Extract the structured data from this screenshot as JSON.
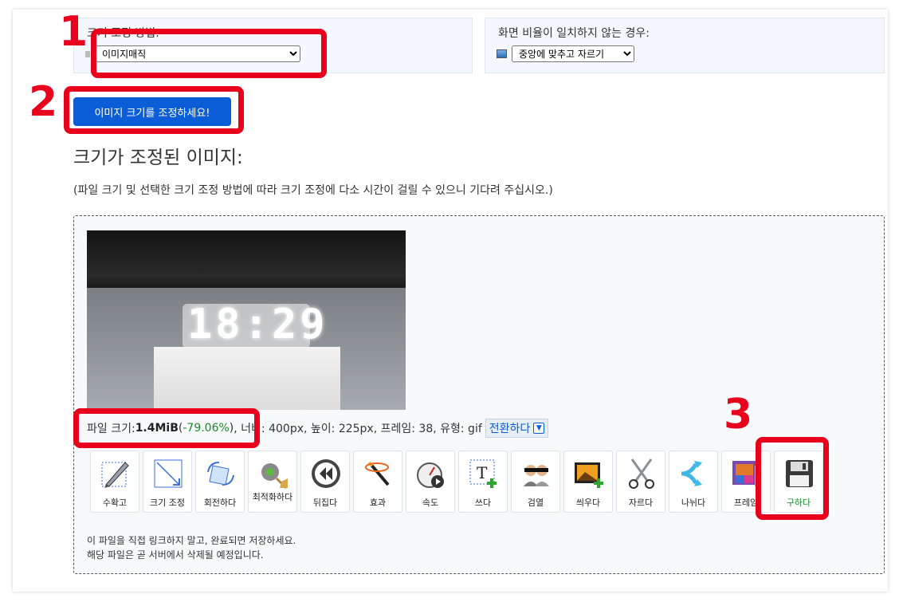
{
  "options": {
    "method_label": "크기 조정 방법:",
    "method_value": "이미지매직",
    "aspect_label": "화면 비율이 일치하지 않는 경우:",
    "aspect_value": "중앙에 맞추고 자르기"
  },
  "annotations": {
    "n1": "1",
    "n2": "2",
    "n3": "3"
  },
  "resize_button": "이미지 크기를 조정하세요!",
  "section_title": "크기가 조정된 이미지:",
  "wait_note": "(파일 크기 및 선택한 크기 조정 방법에 따라 크기 조정에 다소 시간이 걸릴 수 있으니 기다려 주십시오.)",
  "preview": {
    "clock_text": "18:29"
  },
  "file_info": {
    "size_label": "파일 크기: ",
    "size_value": "1.4MiB",
    "open_paren": " (",
    "percent": "-79.06%",
    "close_paren": " )",
    "rest": ", 너비: 400px, 높이: 225px, 프레임: 38, 유형: gif",
    "convert_label": "전환하다"
  },
  "tools": [
    {
      "label": "수확고",
      "icon": "crop-icon"
    },
    {
      "label": "크기 조정",
      "icon": "resize-icon"
    },
    {
      "label": "회전하다",
      "icon": "rotate-icon"
    },
    {
      "label": "최적화하다",
      "icon": "optimize-icon"
    },
    {
      "label": "뒤집다",
      "icon": "reverse-icon"
    },
    {
      "label": "효과",
      "icon": "effects-icon"
    },
    {
      "label": "속도",
      "icon": "speed-icon"
    },
    {
      "label": "쓰다",
      "icon": "write-text-icon"
    },
    {
      "label": "검열",
      "icon": "censor-icon"
    },
    {
      "label": "씌우다",
      "icon": "overlay-icon"
    },
    {
      "label": "자르다",
      "icon": "cut-icon"
    },
    {
      "label": "나뉘다",
      "icon": "split-icon"
    },
    {
      "label": "프레임",
      "icon": "frames-icon"
    },
    {
      "label": "구하다",
      "icon": "save-icon"
    }
  ],
  "footer_note": {
    "line1": "이 파일을 직접 링크하지 말고, 완료되면 저장하세요.",
    "line2": "해당 파일은 곧 서버에서 삭제될 예정입니다."
  },
  "colors": {
    "annotation_red": "#e8001c",
    "button_blue": "#0b5ed7",
    "save_green": "#1a8a2c"
  }
}
